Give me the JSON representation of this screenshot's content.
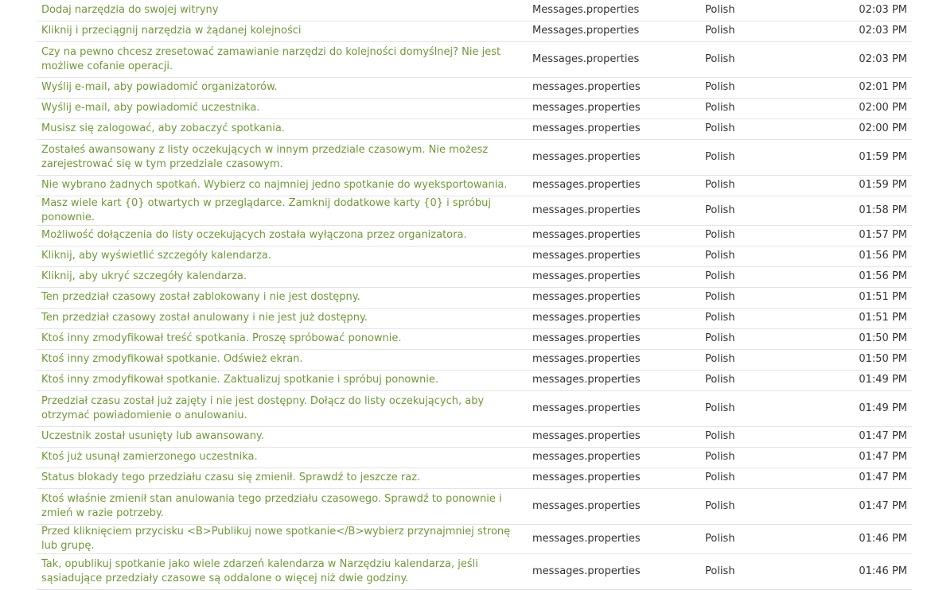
{
  "rows": [
    {
      "text": "Dodaj narzędzia do swojej witryny",
      "file": "Messages.properties",
      "lang": "Polish",
      "time": "02:03 PM",
      "tall": false
    },
    {
      "text": "Kliknij i przeciągnij narzędzia w żądanej kolejności",
      "file": "Messages.properties",
      "lang": "Polish",
      "time": "02:03 PM",
      "tall": false
    },
    {
      "text": "Czy na pewno chcesz zresetować zamawianie narzędzi do kolejności domyślnej? Nie jest możliwe cofanie operacji.",
      "file": "Messages.properties",
      "lang": "Polish",
      "time": "02:03 PM",
      "tall": true
    },
    {
      "text": "Wyślij e-mail, aby powiadomić organizatorów.",
      "file": "messages.properties",
      "lang": "Polish",
      "time": "02:01 PM",
      "tall": false
    },
    {
      "text": "Wyślij e-mail, aby powiadomić uczestnika.",
      "file": "messages.properties",
      "lang": "Polish",
      "time": "02:00 PM",
      "tall": false
    },
    {
      "text": "Musisz się zalogować, aby zobaczyć spotkania.",
      "file": "messages.properties",
      "lang": "Polish",
      "time": "02:00 PM",
      "tall": false
    },
    {
      "text": "Zostałeś awansowany z listy oczekujących w innym przedziale czasowym. Nie możesz zarejestrować się w tym przedziale czasowym.",
      "file": "messages.properties",
      "lang": "Polish",
      "time": "01:59 PM",
      "tall": true
    },
    {
      "text": "Nie wybrano żadnych spotkań. Wybierz co najmniej jedno spotkanie do wyeksportowania.",
      "file": "messages.properties",
      "lang": "Polish",
      "time": "01:59 PM",
      "tall": false
    },
    {
      "text": "Masz wiele kart {0} otwartych w przeglądarce. Zamknij dodatkowe karty {0} i spróbuj ponownie.",
      "file": "messages.properties",
      "lang": "Polish",
      "time": "01:58 PM",
      "tall": false
    },
    {
      "text": "Możliwość dołączenia do listy oczekujących została wyłączona przez organizatora.",
      "file": "messages.properties",
      "lang": "Polish",
      "time": "01:57 PM",
      "tall": false
    },
    {
      "text": "Kliknij, aby wyświetlić szczegóły kalendarza.",
      "file": "messages.properties",
      "lang": "Polish",
      "time": "01:56 PM",
      "tall": false
    },
    {
      "text": "Kliknij, aby ukryć szczegóły kalendarza.",
      "file": "messages.properties",
      "lang": "Polish",
      "time": "01:56 PM",
      "tall": false
    },
    {
      "text": "Ten przedział czasowy został zablokowany i nie jest dostępny.",
      "file": "messages.properties",
      "lang": "Polish",
      "time": "01:51 PM",
      "tall": false
    },
    {
      "text": "Ten przedział czasowy został anulowany i nie jest już dostępny.",
      "file": "messages.properties",
      "lang": "Polish",
      "time": "01:51 PM",
      "tall": false
    },
    {
      "text": "Ktoś inny zmodyfikował treść spotkania. Proszę spróbować ponownie.",
      "file": "messages.properties",
      "lang": "Polish",
      "time": "01:50 PM",
      "tall": false
    },
    {
      "text": "Ktoś inny zmodyfikował spotkanie. Odśwież ekran.",
      "file": "messages.properties",
      "lang": "Polish",
      "time": "01:50 PM",
      "tall": false
    },
    {
      "text": "Ktoś inny zmodyfikował spotkanie. Zaktualizuj spotkanie i spróbuj ponownie.",
      "file": "messages.properties",
      "lang": "Polish",
      "time": "01:49 PM",
      "tall": false
    },
    {
      "text": "Przedział czasu został już zajęty i nie jest dostępny. Dołącz do listy oczekujących, aby otrzymać powiadomienie o anulowaniu.",
      "file": "messages.properties",
      "lang": "Polish",
      "time": "01:49 PM",
      "tall": true
    },
    {
      "text": "Uczestnik został usunięty lub awansowany.",
      "file": "messages.properties",
      "lang": "Polish",
      "time": "01:47 PM",
      "tall": false
    },
    {
      "text": "Ktoś już usunął zamierzonego uczestnika.",
      "file": "messages.properties",
      "lang": "Polish",
      "time": "01:47 PM",
      "tall": false
    },
    {
      "text": "Status blokady tego przedziału czasu się zmienił. Sprawdź to jeszcze raz.",
      "file": "messages.properties",
      "lang": "Polish",
      "time": "01:47 PM",
      "tall": false
    },
    {
      "text": "Ktoś właśnie zmienił stan anulowania tego przedziału czasowego. Sprawdź to ponownie i zmień w razie potrzeby.",
      "file": "messages.properties",
      "lang": "Polish",
      "time": "01:47 PM",
      "tall": true
    },
    {
      "text": "Przed kliknięciem przycisku <B>Publikuj nowe spotkanie</B>wybierz przynajmniej stronę lub grupę.",
      "file": "messages.properties",
      "lang": "Polish",
      "time": "01:46 PM",
      "tall": false
    },
    {
      "text": "Tak, opublikuj spotkanie jako wiele zdarzeń kalendarza w Narzędziu kalendarza, jeśli sąsiadujące przedziały czasowe są oddalone o więcej niż dwie godziny.",
      "file": "messages.properties",
      "lang": "Polish",
      "time": "01:46 PM",
      "tall": true
    }
  ],
  "colors": {
    "link": "#6f9a37",
    "text": "#333333",
    "divider": "#e4e4e4"
  }
}
